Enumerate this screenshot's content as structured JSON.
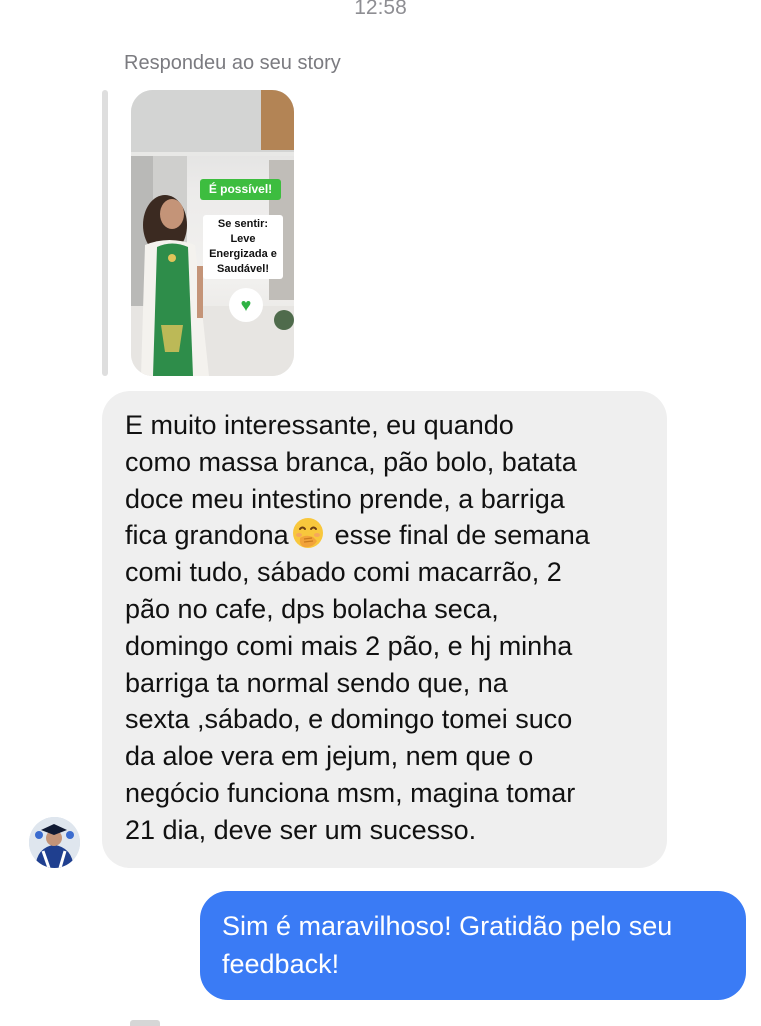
{
  "header": {
    "timestamp": "12:58"
  },
  "story_reply": {
    "caption": "Respondeu ao seu story",
    "story": {
      "sticker_primary": "É possível!",
      "sticker_lines": [
        "Se sentir:",
        "Leve",
        "Energizada e",
        "Saudável!"
      ],
      "badge_icon": "green-heart-icon"
    }
  },
  "messages": [
    {
      "direction": "incoming",
      "lines": [
        "E muito interessante,  eu quando",
        "como massa branca, pão bolo, batata",
        "doce meu intestino prende, a barriga",
        "fica grandona",
        "esse final de semana",
        "comi tudo, sábado comi macarrão, 2",
        "pão no cafe, dps bolacha seca,",
        "domingo comi mais 2 pão, e hj minha",
        "barriga ta normal sendo que, na",
        "sexta ,sábado, e domingo tomei suco",
        "da aloe vera  em jejum, nem que o",
        "negócio funciona msm, magina tomar",
        "21 dia, deve ser um sucesso."
      ],
      "inline_emoji": "face-with-hand-over-mouth-icon"
    },
    {
      "direction": "outgoing",
      "lines": [
        "Sim é maravilhoso! Gratidão pelo seu",
        "feedback!"
      ]
    }
  ],
  "colors": {
    "incoming_bubble": "#efefef",
    "outgoing_bubble": "#3a7bf5",
    "sticker_green": "#3dbd3f"
  }
}
